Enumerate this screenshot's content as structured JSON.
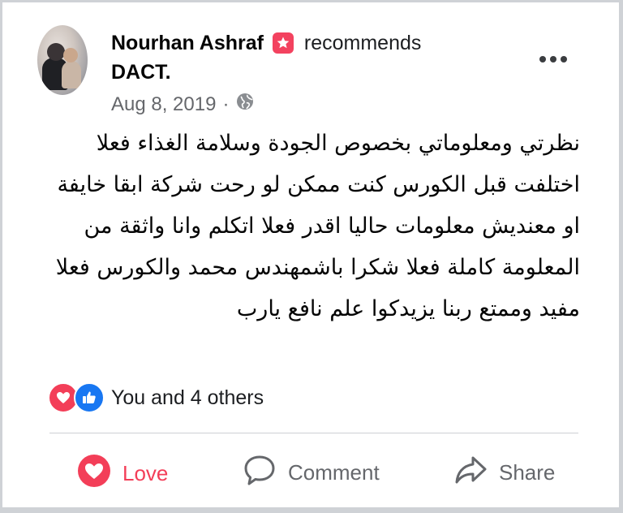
{
  "post": {
    "author": "Nourhan Ashraf",
    "recommends_text": "recommends",
    "page_name": "DACT.",
    "date": "Aug 8, 2019",
    "separator": "·",
    "privacy_icon": "globe-icon",
    "text": "نظرتي ومعلوماتي بخصوص الجودة وسلامة الغذاء فعلا اختلفت قبل الكورس كنت ممكن لو رحت شركة ابقا خايفة او معنديش معلومات حاليا اقدر فعلا اتكلم وانا واثقة من المعلومة كاملة فعلا شكرا باشمهندس محمد والكورس فعلا مفيد وممتع ربنا يزيدكوا علم نافع يارب"
  },
  "reactions": {
    "icons": [
      "love-icon",
      "like-icon"
    ],
    "summary": "You and 4 others"
  },
  "actions": {
    "love_label": "Love",
    "comment_label": "Comment",
    "share_label": "Share"
  },
  "colors": {
    "love": "#f33e58",
    "like": "#1877f2",
    "recommend_badge": "#f3425f",
    "secondary_text": "#65676b"
  }
}
